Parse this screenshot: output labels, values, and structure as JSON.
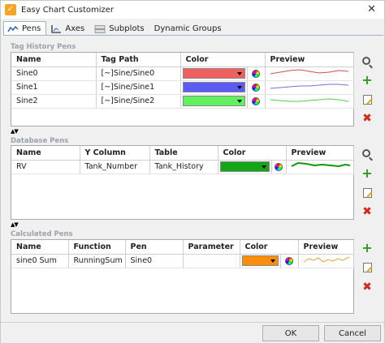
{
  "window": {
    "title": "Easy Chart Customizer",
    "close_glyph": "✕",
    "app_icon_glyph": "✓"
  },
  "tabs": [
    {
      "label": "Pens",
      "icon": "pens-icon"
    },
    {
      "label": "Axes",
      "icon": "axes-icon"
    },
    {
      "label": "Subplots",
      "icon": "subplots-icon"
    },
    {
      "label": "Dynamic Groups",
      "icon": ""
    }
  ],
  "tag_history": {
    "section_label": "Tag History Pens",
    "columns": [
      "Name",
      "Tag Path",
      "Color",
      "Preview"
    ],
    "rows": [
      {
        "name": "Sine0",
        "path": "[~]Sine/Sine0",
        "color": "#f0605f",
        "line_color": "#d94b4b"
      },
      {
        "name": "Sine1",
        "path": "[~]Sine/Sine1",
        "color": "#5b5bf5",
        "line_color": "#7a6fd6"
      },
      {
        "name": "Sine2",
        "path": "[~]Sine/Sine2",
        "color": "#62f060",
        "line_color": "#4ccf4a"
      }
    ]
  },
  "database": {
    "section_label": "Database Pens",
    "columns": [
      "Name",
      "Y Column",
      "Table",
      "Color",
      "Preview"
    ],
    "rows": [
      {
        "name": "RV",
        "y_column": "Tank_Number",
        "table": "Tank_History",
        "color": "#14a614",
        "line_color": "#0b9a0b"
      }
    ]
  },
  "calculated": {
    "section_label": "Calculated Pens",
    "columns": [
      "Name",
      "Function",
      "Pen",
      "Parameter",
      "Color",
      "Preview"
    ],
    "rows": [
      {
        "name": "sine0 Sum",
        "function": "RunningSum",
        "pen": "Sine0",
        "parameter": "",
        "color": "#ff8c0a",
        "line_color": "#f0a030"
      }
    ]
  },
  "splitter_glyph": "▲▼",
  "buttons": {
    "ok": "OK",
    "cancel": "Cancel"
  },
  "colors": {
    "add": "#2e9a1e",
    "remove": "#d42a1a",
    "header_label": "#9aa3ad",
    "tab_border": "#9fb3c8"
  },
  "side_icons": [
    "search-icon",
    "add-icon",
    "edit-icon",
    "delete-icon"
  ]
}
